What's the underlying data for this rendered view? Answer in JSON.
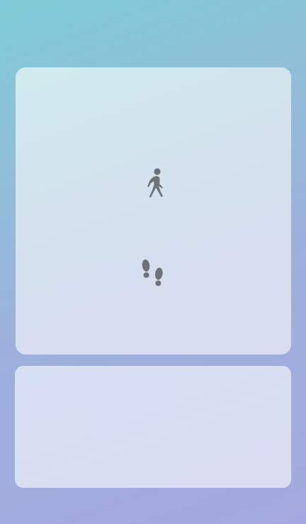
{
  "theme": {
    "icon_color": "#6e7276"
  },
  "main_card": {
    "icons": [
      "walk-icon",
      "footprints-icon"
    ]
  }
}
